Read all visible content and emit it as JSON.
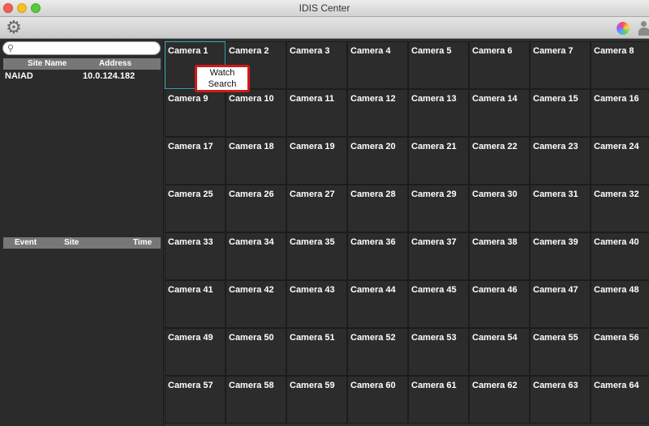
{
  "window": {
    "title": "IDIS Center"
  },
  "toolbar": {
    "settings_icon": "gear-icon",
    "color_icon": "color-wheel-icon",
    "user_icon": "user-icon"
  },
  "sidebar": {
    "search": {
      "value": "",
      "placeholder": ""
    },
    "site_table": {
      "headers": [
        "Site Name",
        "Address"
      ],
      "rows": [
        {
          "site_name": "NAIAD",
          "address": "10.0.124.182"
        }
      ]
    },
    "event_table": {
      "headers": [
        "Event",
        "Site",
        "Time"
      ],
      "rows": []
    }
  },
  "context_menu": {
    "items": [
      "Watch",
      "Search"
    ]
  },
  "grid": {
    "columns": 8,
    "rows": 8,
    "selected_camera": "Camera 1",
    "cameras": [
      "Camera 1",
      "Camera 2",
      "Camera 3",
      "Camera 4",
      "Camera 5",
      "Camera 6",
      "Camera 7",
      "Camera 8",
      "Camera 9",
      "Camera 10",
      "Camera 11",
      "Camera 12",
      "Camera 13",
      "Camera 14",
      "Camera 15",
      "Camera 16",
      "Camera 17",
      "Camera 18",
      "Camera 19",
      "Camera 20",
      "Camera 21",
      "Camera 22",
      "Camera 23",
      "Camera 24",
      "Camera 25",
      "Camera 26",
      "Camera 27",
      "Camera 28",
      "Camera 29",
      "Camera 30",
      "Camera 31",
      "Camera 32",
      "Camera 33",
      "Camera 34",
      "Camera 35",
      "Camera 36",
      "Camera 37",
      "Camera 38",
      "Camera 39",
      "Camera 40",
      "Camera 41",
      "Camera 42",
      "Camera 43",
      "Camera 44",
      "Camera 45",
      "Camera 46",
      "Camera 47",
      "Camera 48",
      "Camera 49",
      "Camera 50",
      "Camera 51",
      "Camera 52",
      "Camera 53",
      "Camera 54",
      "Camera 55",
      "Camera 56",
      "Camera 57",
      "Camera 58",
      "Camera 59",
      "Camera 60",
      "Camera 61",
      "Camera 62",
      "Camera 63",
      "Camera 64"
    ]
  }
}
